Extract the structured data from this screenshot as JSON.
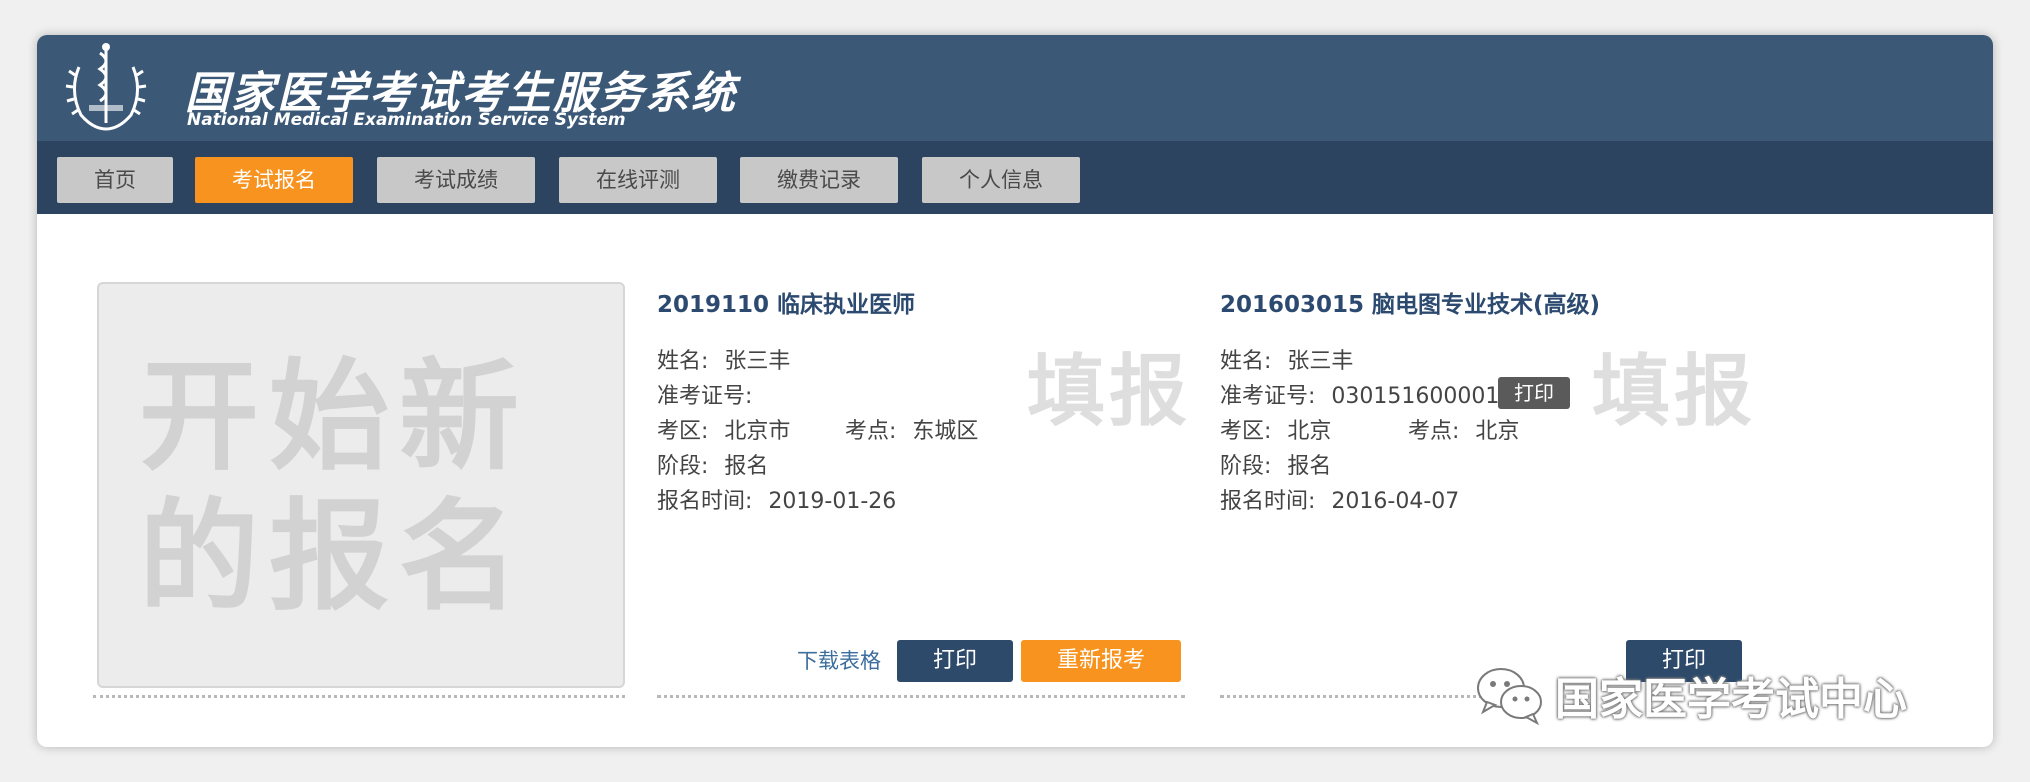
{
  "header": {
    "title_cn": "国家医学考试考生服务系统",
    "title_en": "National Medical Examination Service System"
  },
  "nav": {
    "items": [
      {
        "label": "首页"
      },
      {
        "label": "考试报名",
        "active": true
      },
      {
        "label": "考试成绩"
      },
      {
        "label": "在线评测"
      },
      {
        "label": "缴费记录"
      },
      {
        "label": "个人信息"
      }
    ]
  },
  "new_registration": {
    "line1": "开始新",
    "line2": "的报名"
  },
  "cards": [
    {
      "title": "2019110 临床执业医师",
      "fields": {
        "name_label": "姓名:",
        "name": "张三丰",
        "ticket_label": "准考证号:",
        "ticket": "",
        "region_label": "考区:",
        "region": "北京市",
        "site_label": "考点:",
        "site": "东城区",
        "stage_label": "阶段:",
        "stage": "报名",
        "time_label": "报名时间:",
        "time": "2019-01-26"
      },
      "watermark": "填报",
      "actions": {
        "download_label": "下载表格",
        "print_label": "打印",
        "reapply_label": "重新报考"
      }
    },
    {
      "title": "201603015 脑电图专业技术(高级)",
      "fields": {
        "name_label": "姓名:",
        "name": "张三丰",
        "ticket_label": "准考证号:",
        "ticket": "030151600001",
        "region_label": "考区:",
        "region": "北京",
        "site_label": "考点:",
        "site": "北京",
        "stage_label": "阶段:",
        "stage": "报名",
        "time_label": "报名时间:",
        "time": "2016-04-07"
      },
      "watermark": "填报",
      "actions": {
        "ticket_print_label": "打印",
        "print_label": "打印"
      }
    }
  ],
  "wechat_watermark": "国家医学考试中心",
  "colors": {
    "header_bg": "#3b5877",
    "nav_bg": "#2c4460",
    "accent": "#f7931e",
    "button_dark": "#2d4a6b"
  }
}
